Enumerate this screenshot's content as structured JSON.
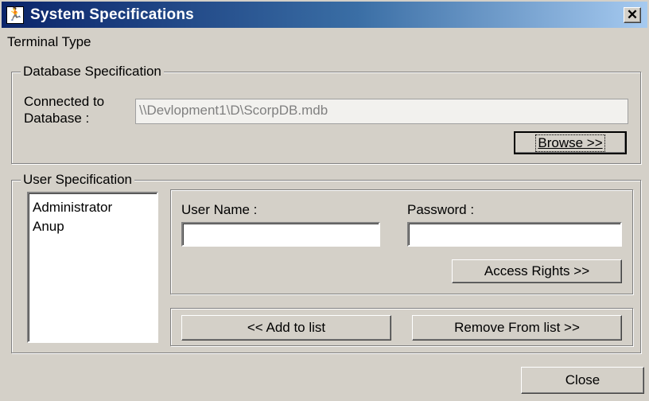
{
  "window": {
    "title": "System Specifications",
    "app_icon": "running-figure-icon",
    "close_glyph": "✕"
  },
  "menu": {
    "terminal_type": "Terminal Type"
  },
  "database_spec": {
    "legend": "Database Specification",
    "connected_label_line1": "Connected to",
    "connected_label_line2": "Database :",
    "path_value": "\\\\Devlopment1\\D\\ScorpDB.mdb",
    "browse_label": "Browse >>"
  },
  "user_spec": {
    "legend": "User Specification",
    "users": [
      "Administrator",
      "Anup"
    ],
    "user_name_label": "User Name :",
    "user_name_value": "",
    "password_label": "Password :",
    "password_value": "",
    "access_rights_label": "Access Rights >>",
    "add_to_list_label": "<<  Add to list",
    "remove_from_list_label": "Remove From list >>"
  },
  "footer": {
    "close_label": "Close"
  }
}
